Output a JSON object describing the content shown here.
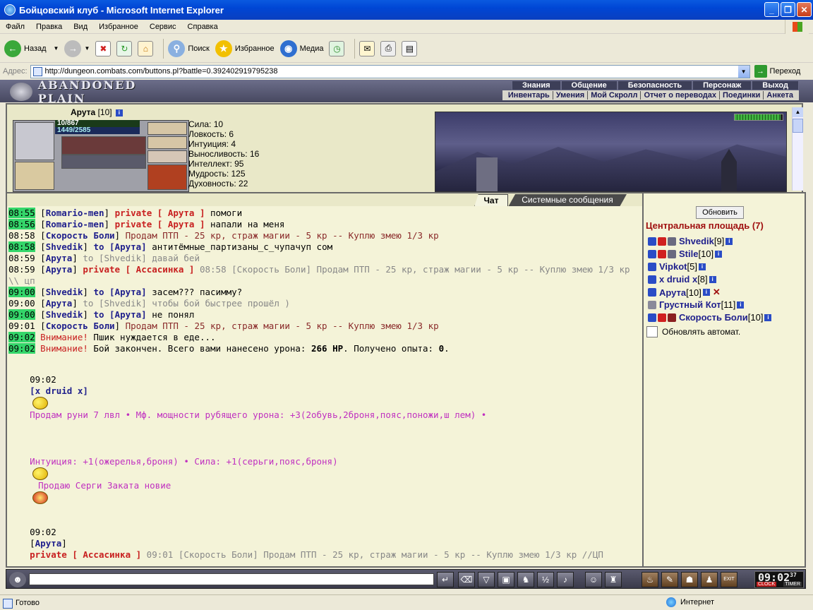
{
  "window": {
    "title": "Бойцовский клуб - Microsoft Internet Explorer"
  },
  "menu": [
    "Файл",
    "Правка",
    "Вид",
    "Избранное",
    "Сервис",
    "Справка"
  ],
  "toolbar": {
    "back": "Назад",
    "search": "Поиск",
    "favorites": "Избранное",
    "media": "Медиа"
  },
  "address": {
    "label": "Адрес:",
    "url": "http://dungeon.combats.com/buttons.pl?battle=0.392402919795238",
    "go": "Переход"
  },
  "game": {
    "logo": "ABANDONED PLAIN",
    "topnav": [
      "Знания",
      "Общение",
      "Безопасность",
      "Персонаж",
      "Выход"
    ],
    "subnav": [
      "Инвентарь",
      "Умения",
      "Мой Скролл",
      "Отчет о переводах",
      "Поединки",
      "Анкета"
    ]
  },
  "character": {
    "name": "Арута",
    "level": "[10]",
    "hp": "10/867",
    "mana": "1449/2585",
    "stats": [
      "Сила: 10",
      "Ловкость: 6",
      "Интуиция: 4",
      "Выносливость: 16",
      "Интеллект: 95",
      "Мудрость: 125",
      "Духовность: 22"
    ]
  },
  "tabs": {
    "chat": "Чат",
    "system": "Системные сообщения"
  },
  "chat": [
    {
      "time": "08:55",
      "hl": true,
      "parts": [
        {
          "c": "plain",
          "t": "["
        },
        {
          "c": "nick",
          "t": "Romario-men"
        },
        {
          "c": "plain",
          "t": "] "
        },
        {
          "c": "priv",
          "t": "private [ Арута ]"
        },
        {
          "c": "plain",
          "t": " помоги"
        }
      ]
    },
    {
      "time": "08:56",
      "hl": true,
      "parts": [
        {
          "c": "plain",
          "t": "["
        },
        {
          "c": "nick",
          "t": "Romario-men"
        },
        {
          "c": "plain",
          "t": "] "
        },
        {
          "c": "priv",
          "t": "private [ Арута ]"
        },
        {
          "c": "plain",
          "t": " напали на меня"
        }
      ]
    },
    {
      "time": "08:58",
      "hl": false,
      "parts": [
        {
          "c": "plain",
          "t": "["
        },
        {
          "c": "nick",
          "t": "Скорость Боли"
        },
        {
          "c": "plain",
          "t": "] "
        },
        {
          "c": "sysplain",
          "t": "Продам ПТП - 25 кр, страж магии - 5 кр -- Куплю змею 1/3 кр"
        }
      ]
    },
    {
      "time": "08:58",
      "hl": true,
      "parts": [
        {
          "c": "plain",
          "t": "["
        },
        {
          "c": "nick",
          "t": "Shvedik"
        },
        {
          "c": "plain",
          "t": "] "
        },
        {
          "c": "nick",
          "t": "to [Арута]"
        },
        {
          "c": "plain",
          "t": " антитёмные_партизаны_с_чупачуп сом"
        }
      ]
    },
    {
      "time": "08:59",
      "hl": false,
      "parts": [
        {
          "c": "plain",
          "t": "["
        },
        {
          "c": "nick",
          "t": "Арута"
        },
        {
          "c": "plain",
          "t": "] "
        },
        {
          "c": "gray",
          "t": "to [Shvedik] давай бей"
        }
      ]
    },
    {
      "time": "08:59",
      "hl": false,
      "parts": [
        {
          "c": "plain",
          "t": "["
        },
        {
          "c": "nick",
          "t": "Арута"
        },
        {
          "c": "plain",
          "t": "] "
        },
        {
          "c": "priv",
          "t": "private [ Ассасинка ]"
        },
        {
          "c": "gray",
          "t": " 08:58 [Скорость Боли] Продам ПТП - 25 кр, страж магии - 5 кр -- Куплю змею 1/3 кр \\\\ цп"
        }
      ]
    },
    {
      "time": "09:00",
      "hl": true,
      "parts": [
        {
          "c": "plain",
          "t": "["
        },
        {
          "c": "nick",
          "t": "Shvedik"
        },
        {
          "c": "plain",
          "t": "] "
        },
        {
          "c": "nick",
          "t": "to [Арута]"
        },
        {
          "c": "plain",
          "t": " засем??? пасимму?"
        }
      ]
    },
    {
      "time": "09:00",
      "hl": false,
      "parts": [
        {
          "c": "plain",
          "t": "["
        },
        {
          "c": "nick",
          "t": "Арута"
        },
        {
          "c": "plain",
          "t": "] "
        },
        {
          "c": "gray",
          "t": "to [Shvedik] чтобы бой быстрее прошёл )"
        }
      ]
    },
    {
      "time": "09:00",
      "hl": true,
      "parts": [
        {
          "c": "plain",
          "t": "["
        },
        {
          "c": "nick",
          "t": "Shvedik"
        },
        {
          "c": "plain",
          "t": "] "
        },
        {
          "c": "nick",
          "t": "to [Арута]"
        },
        {
          "c": "plain",
          "t": " не понял"
        }
      ]
    },
    {
      "time": "09:01",
      "hl": false,
      "parts": [
        {
          "c": "plain",
          "t": "["
        },
        {
          "c": "nick",
          "t": "Скорость Боли"
        },
        {
          "c": "plain",
          "t": "] "
        },
        {
          "c": "sysplain",
          "t": "Продам ПТП - 25 кр, страж магии - 5 кр -- Куплю змею 1/3 кр"
        }
      ]
    },
    {
      "time": "09:02",
      "hl": true,
      "parts": [
        {
          "c": "sys",
          "t": "Внимание!"
        },
        {
          "c": "plain",
          "t": " Пшик нуждается в еде..."
        }
      ]
    },
    {
      "time": "09:02",
      "hl": true,
      "parts": [
        {
          "c": "sys",
          "t": "Внимание!"
        },
        {
          "c": "plain",
          "t": " Бой закончен. Всего вами нанесено урона: "
        },
        {
          "c": "bold",
          "t": "266 HP"
        },
        {
          "c": "plain",
          "t": ". Получено опыта: "
        },
        {
          "c": "bold",
          "t": "0"
        },
        {
          "c": "plain",
          "t": "."
        }
      ]
    }
  ],
  "chat_ad": {
    "time": "09:02",
    "nick": "[x druid x]",
    "text1": "Продам руни 7 лвл • Мф. мощности рубящего урона: +3(2обувь,2броня,пояс,поножи,ш лем) •",
    "text2": "Интуиция: +1(ожерелья,броня) • Сила: +1(серьги,пояс,броня)",
    "text3": "Продаю Серги Заката новие"
  },
  "chat_last": {
    "time": "09:02",
    "nick": "Арута",
    "priv": "private [ Ассасинка ]",
    "text": " 09:01 [Скорость Боли] Продам ПТП - 25 кр, страж магии - 5 кр -- Куплю змею 1/3 кр //ЦП"
  },
  "online": {
    "refresh": "Обновить",
    "location": "Центральная площадь (7)",
    "users": [
      {
        "name": "Shvedik",
        "level": "[9]"
      },
      {
        "name": "Stile",
        "level": "[10]"
      },
      {
        "name": "Vipkot",
        "level": "[5]"
      },
      {
        "name": "x druid x",
        "level": "[8]"
      },
      {
        "name": "Арута",
        "level": "[10]"
      },
      {
        "name": "Грустный Кот",
        "level": "[11]"
      },
      {
        "name": "Скорость Боли",
        "level": "[10]"
      }
    ],
    "auto_refresh": "Обновлять автомат."
  },
  "clock": {
    "time": "09:02",
    "sec": "37",
    "clock_lbl": "CLOCK",
    "timer_lbl": "TIMER",
    "exit": "EXIT"
  },
  "status": {
    "ready": "Готово",
    "zone": "Интернет"
  },
  "colors": {
    "highlight": "#34d66a",
    "nick": "#1f1f8c",
    "private": "#c82020",
    "ad": "#c030c0"
  }
}
